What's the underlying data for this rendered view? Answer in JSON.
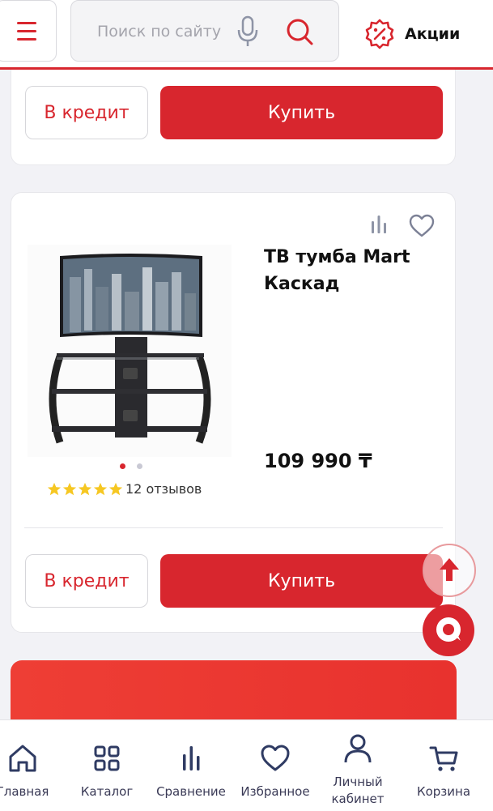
{
  "header": {
    "search_placeholder": "Поиск по сайту",
    "promo_label": "Акции",
    "accent_color": "#d8262e"
  },
  "card_prev": {
    "credit_label": "В кредит",
    "buy_label": "Купить"
  },
  "product": {
    "title": "ТВ тумба Mart Каскад",
    "price": "109 990 ₸",
    "rating_stars": 5,
    "reviews": "12 отзывов",
    "image_dots": 2,
    "active_dot": 1,
    "credit_label": "В кредит",
    "buy_label": "Купить",
    "icons": [
      "compare-icon",
      "heart-icon"
    ]
  },
  "bottom_nav": {
    "items": [
      {
        "label": "Главная",
        "icon": "home-icon"
      },
      {
        "label": "Каталог",
        "icon": "catalog-icon"
      },
      {
        "label": "Сравнение",
        "icon": "compare-icon"
      },
      {
        "label": "Избранное",
        "icon": "heart-icon"
      },
      {
        "label": "Личный кабинет",
        "icon": "user-icon"
      },
      {
        "label": "Корзина",
        "icon": "cart-icon"
      }
    ]
  }
}
